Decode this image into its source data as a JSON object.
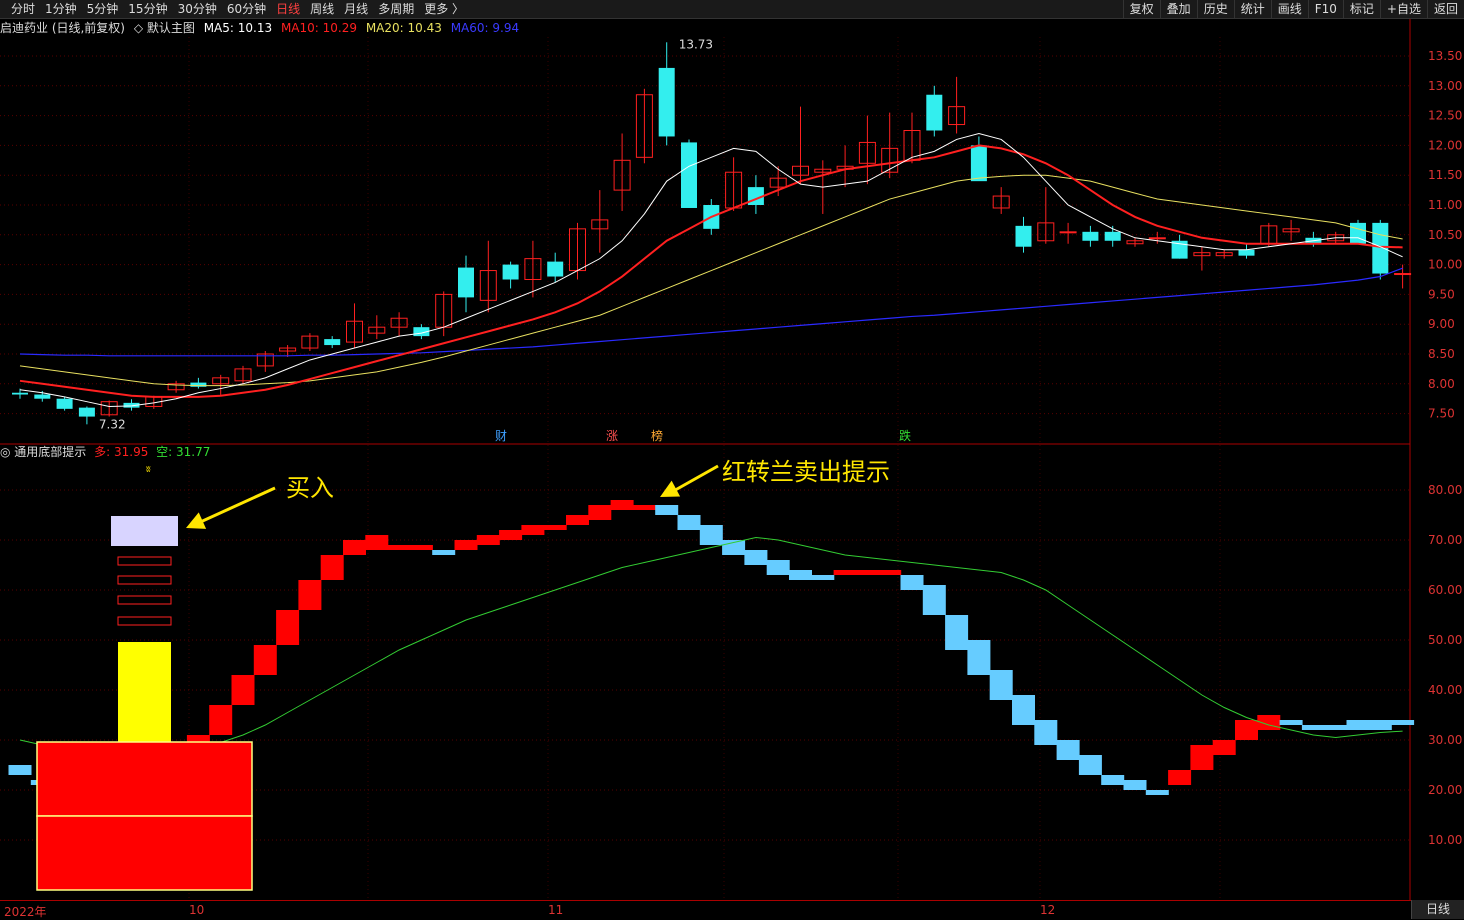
{
  "toolbar": {
    "periods": [
      "分时",
      "1分钟",
      "5分钟",
      "15分钟",
      "30分钟",
      "60分钟",
      "日线",
      "周线",
      "月线",
      "多周期",
      "更多 〉"
    ],
    "active_period": "日线",
    "right_buttons": [
      "复权",
      "叠加",
      "历史",
      "统计",
      "画线",
      "F10",
      "标记",
      "+自选",
      "返回"
    ]
  },
  "main_chart": {
    "stock_name": "启迪药业 (日线,前复权)",
    "template": "◇ 默认主图",
    "ma5": "MA5: 10.13",
    "ma10": "MA10: 10.29",
    "ma20": "MA20: 10.43",
    "ma60": "MA60: 9.94",
    "high_label": "13.73",
    "low_label": "7.32",
    "markers": [
      "财",
      "涨",
      "榜",
      "跌"
    ],
    "y_ticks": [
      "13.50",
      "13.00",
      "12.50",
      "12.00",
      "11.50",
      "11.00",
      "10.50",
      "10.00",
      "9.50",
      "9.00",
      "8.50",
      "8.00",
      "7.50"
    ]
  },
  "indicator": {
    "name": "◎ 通用底部提示",
    "long_label": "多: 31.95",
    "short_label": "空: 31.77",
    "y_ticks": [
      "80.00",
      "70.00",
      "60.00",
      "50.00",
      "40.00",
      "30.00",
      "20.00",
      "10.00"
    ],
    "annotation_buy": "买入",
    "annotation_sell": "红转兰卖出提示"
  },
  "x_axis": {
    "labels": [
      "2022年",
      "10",
      "11",
      "12"
    ],
    "period_button": "日线"
  },
  "colors": {
    "up": "#ff2020",
    "down": "#33eeee",
    "ma5": "#ffffff",
    "ma10": "#ff2020",
    "ma20": "#e8e060",
    "ma60": "#2a2aff",
    "ind_red": "#ff0000",
    "ind_blue": "#66ccff",
    "ind_line": "#33cc33",
    "annotation": "#ffe600"
  },
  "chart_data": {
    "type": "candlestick",
    "candles": [
      [
        7.85,
        7.92,
        7.75,
        7.82
      ],
      [
        7.82,
        7.88,
        7.7,
        7.75
      ],
      [
        7.75,
        7.78,
        7.55,
        7.58
      ],
      [
        7.6,
        7.62,
        7.32,
        7.45
      ],
      [
        7.48,
        7.72,
        7.45,
        7.7
      ],
      [
        7.68,
        7.74,
        7.55,
        7.6
      ],
      [
        7.62,
        7.8,
        7.58,
        7.78
      ],
      [
        7.9,
        8.05,
        7.85,
        8.0
      ],
      [
        8.02,
        8.1,
        7.92,
        7.95
      ],
      [
        8.0,
        8.15,
        7.8,
        8.1
      ],
      [
        8.05,
        8.3,
        8.0,
        8.25
      ],
      [
        8.3,
        8.55,
        8.2,
        8.5
      ],
      [
        8.55,
        8.65,
        8.45,
        8.6
      ],
      [
        8.6,
        8.85,
        8.55,
        8.8
      ],
      [
        8.75,
        8.8,
        8.6,
        8.65
      ],
      [
        8.7,
        9.35,
        8.6,
        9.05
      ],
      [
        8.85,
        9.15,
        8.75,
        8.95
      ],
      [
        8.95,
        9.2,
        8.8,
        9.1
      ],
      [
        8.95,
        9.0,
        8.75,
        8.8
      ],
      [
        8.95,
        9.55,
        8.8,
        9.5
      ],
      [
        9.95,
        10.15,
        9.2,
        9.45
      ],
      [
        9.4,
        10.4,
        9.2,
        9.9
      ],
      [
        10.0,
        10.05,
        9.6,
        9.75
      ],
      [
        9.75,
        10.4,
        9.45,
        10.1
      ],
      [
        10.05,
        10.2,
        9.7,
        9.8
      ],
      [
        9.9,
        10.7,
        9.75,
        10.6
      ],
      [
        10.6,
        11.25,
        10.2,
        10.75
      ],
      [
        11.25,
        12.2,
        10.9,
        11.75
      ],
      [
        11.8,
        12.95,
        11.7,
        12.85
      ],
      [
        13.3,
        13.73,
        12.0,
        12.15
      ],
      [
        12.05,
        12.1,
        10.95,
        10.95
      ],
      [
        11.0,
        11.1,
        10.5,
        10.6
      ],
      [
        10.95,
        11.8,
        10.9,
        11.55
      ],
      [
        11.3,
        11.5,
        10.85,
        11.0
      ],
      [
        11.3,
        11.65,
        11.15,
        11.45
      ],
      [
        11.5,
        12.65,
        11.35,
        11.65
      ],
      [
        11.55,
        11.75,
        10.85,
        11.6
      ],
      [
        11.6,
        12.0,
        11.3,
        11.65
      ],
      [
        11.7,
        12.5,
        11.35,
        12.05
      ],
      [
        11.55,
        12.55,
        11.45,
        11.95
      ],
      [
        11.75,
        12.55,
        11.7,
        12.25
      ],
      [
        12.85,
        13.0,
        12.15,
        12.25
      ],
      [
        12.35,
        13.15,
        12.2,
        12.65
      ],
      [
        12.0,
        12.15,
        11.45,
        11.4
      ],
      [
        10.95,
        11.3,
        10.85,
        11.15
      ],
      [
        10.65,
        10.8,
        10.2,
        10.3
      ],
      [
        10.4,
        11.3,
        10.35,
        10.7
      ],
      [
        10.55,
        10.7,
        10.35,
        10.55
      ],
      [
        10.55,
        10.65,
        10.3,
        10.4
      ],
      [
        10.55,
        10.65,
        10.3,
        10.4
      ],
      [
        10.35,
        10.45,
        10.3,
        10.4
      ],
      [
        10.45,
        10.55,
        10.35,
        10.45
      ],
      [
        10.4,
        10.5,
        10.1,
        10.1
      ],
      [
        10.15,
        10.3,
        9.9,
        10.2
      ],
      [
        10.15,
        10.25,
        10.1,
        10.2
      ],
      [
        10.25,
        10.35,
        10.1,
        10.15
      ],
      [
        10.35,
        10.7,
        10.3,
        10.65
      ],
      [
        10.55,
        10.75,
        10.4,
        10.6
      ],
      [
        10.45,
        10.55,
        10.3,
        10.35
      ],
      [
        10.4,
        10.55,
        10.35,
        10.5
      ],
      [
        10.7,
        10.75,
        10.35,
        10.35
      ],
      [
        10.7,
        10.75,
        9.75,
        9.85
      ],
      [
        9.85,
        10.0,
        9.6,
        9.85
      ]
    ],
    "ma5": [
      7.9,
      7.85,
      7.78,
      7.7,
      7.62,
      7.63,
      7.68,
      7.75,
      7.85,
      7.92,
      8.0,
      8.1,
      8.25,
      8.4,
      8.5,
      8.6,
      8.7,
      8.8,
      8.85,
      8.95,
      9.1,
      9.25,
      9.4,
      9.55,
      9.7,
      9.9,
      10.1,
      10.4,
      10.85,
      11.4,
      11.65,
      11.8,
      11.95,
      11.9,
      11.6,
      11.35,
      11.3,
      11.35,
      11.4,
      11.6,
      11.8,
      11.9,
      12.1,
      12.2,
      12.1,
      11.8,
      11.4,
      11.0,
      10.8,
      10.6,
      10.45,
      10.4,
      10.35,
      10.3,
      10.25,
      10.25,
      10.3,
      10.35,
      10.4,
      10.45,
      10.45,
      10.3,
      10.13
    ],
    "ma10": [
      8.05,
      8.0,
      7.95,
      7.9,
      7.85,
      7.8,
      7.78,
      7.78,
      7.78,
      7.8,
      7.85,
      7.9,
      7.98,
      8.08,
      8.18,
      8.28,
      8.38,
      8.48,
      8.58,
      8.68,
      8.78,
      8.88,
      8.98,
      9.08,
      9.2,
      9.35,
      9.55,
      9.8,
      10.1,
      10.4,
      10.6,
      10.8,
      10.95,
      11.1,
      11.25,
      11.4,
      11.5,
      11.6,
      11.65,
      11.7,
      11.75,
      11.8,
      11.9,
      12.0,
      11.95,
      11.85,
      11.7,
      11.5,
      11.25,
      11.0,
      10.8,
      10.65,
      10.55,
      10.45,
      10.4,
      10.35,
      10.35,
      10.35,
      10.35,
      10.35,
      10.35,
      10.3,
      10.29
    ],
    "ma20": [
      8.3,
      8.25,
      8.2,
      8.15,
      8.1,
      8.05,
      8.0,
      7.98,
      7.97,
      7.97,
      7.98,
      8.0,
      8.02,
      8.05,
      8.1,
      8.15,
      8.2,
      8.28,
      8.36,
      8.45,
      8.55,
      8.65,
      8.75,
      8.85,
      8.95,
      9.05,
      9.15,
      9.3,
      9.45,
      9.6,
      9.75,
      9.9,
      10.05,
      10.2,
      10.35,
      10.5,
      10.65,
      10.8,
      10.95,
      11.1,
      11.2,
      11.3,
      11.4,
      11.45,
      11.48,
      11.5,
      11.5,
      11.45,
      11.4,
      11.3,
      11.2,
      11.1,
      11.05,
      11.0,
      10.95,
      10.9,
      10.85,
      10.8,
      10.75,
      10.7,
      10.6,
      10.5,
      10.43
    ],
    "ma60": [
      8.5,
      8.49,
      8.48,
      8.48,
      8.47,
      8.47,
      8.47,
      8.47,
      8.47,
      8.47,
      8.47,
      8.47,
      8.47,
      8.48,
      8.48,
      8.49,
      8.5,
      8.51,
      8.52,
      8.54,
      8.56,
      8.58,
      8.6,
      8.62,
      8.65,
      8.68,
      8.71,
      8.74,
      8.77,
      8.8,
      8.83,
      8.86,
      8.89,
      8.92,
      8.95,
      8.98,
      9.01,
      9.04,
      9.07,
      9.1,
      9.13,
      9.15,
      9.18,
      9.21,
      9.24,
      9.27,
      9.3,
      9.33,
      9.36,
      9.39,
      9.42,
      9.45,
      9.48,
      9.51,
      9.54,
      9.57,
      9.6,
      9.63,
      9.66,
      9.7,
      9.74,
      9.8,
      9.94
    ],
    "indicator_steps": [
      [
        25,
        23,
        "b"
      ],
      [
        21,
        22,
        "b"
      ],
      [
        20,
        22,
        "b"
      ],
      [
        20,
        21,
        "b"
      ],
      [
        21,
        22,
        "b"
      ],
      [
        22,
        23,
        "b"
      ],
      [
        24,
        25,
        "b"
      ],
      [
        25,
        26,
        "r"
      ],
      [
        27,
        31,
        "r"
      ],
      [
        31,
        37,
        "r"
      ],
      [
        37,
        43,
        "r"
      ],
      [
        43,
        49,
        "r"
      ],
      [
        49,
        56,
        "r"
      ],
      [
        56,
        62,
        "r"
      ],
      [
        62,
        67,
        "r"
      ],
      [
        67,
        70,
        "r"
      ],
      [
        68,
        71,
        "r"
      ],
      [
        68,
        69,
        "r"
      ],
      [
        68,
        69,
        "r"
      ],
      [
        67,
        68,
        "b"
      ],
      [
        68,
        70,
        "r"
      ],
      [
        69,
        71,
        "r"
      ],
      [
        70,
        72,
        "r"
      ],
      [
        71,
        73,
        "r"
      ],
      [
        72,
        73,
        "r"
      ],
      [
        73,
        75,
        "r"
      ],
      [
        74,
        77,
        "r"
      ],
      [
        76,
        78,
        "r"
      ],
      [
        76,
        77,
        "r"
      ],
      [
        75,
        77,
        "b"
      ],
      [
        72,
        75,
        "b"
      ],
      [
        69,
        73,
        "b"
      ],
      [
        67,
        70,
        "b"
      ],
      [
        65,
        68,
        "b"
      ],
      [
        63,
        66,
        "b"
      ],
      [
        62,
        64,
        "b"
      ],
      [
        62,
        63,
        "b"
      ],
      [
        63,
        64,
        "r"
      ],
      [
        63,
        64,
        "r"
      ],
      [
        63,
        64,
        "r"
      ],
      [
        60,
        63,
        "b"
      ],
      [
        55,
        61,
        "b"
      ],
      [
        48,
        55,
        "b"
      ],
      [
        43,
        50,
        "b"
      ],
      [
        38,
        44,
        "b"
      ],
      [
        33,
        39,
        "b"
      ],
      [
        29,
        34,
        "b"
      ],
      [
        26,
        30,
        "b"
      ],
      [
        23,
        27,
        "b"
      ],
      [
        21,
        23,
        "b"
      ],
      [
        20,
        22,
        "b"
      ],
      [
        19,
        20,
        "b"
      ],
      [
        21,
        24,
        "r"
      ],
      [
        24,
        29,
        "r"
      ],
      [
        27,
        30,
        "r"
      ],
      [
        30,
        34,
        "r"
      ],
      [
        32,
        35,
        "r"
      ],
      [
        33,
        34,
        "b"
      ],
      [
        32,
        33,
        "b"
      ],
      [
        32,
        33,
        "b"
      ],
      [
        32,
        34,
        "b"
      ],
      [
        32,
        34,
        "b"
      ],
      [
        33,
        34,
        "b"
      ]
    ],
    "indicator_line": [
      30,
      29,
      28,
      27.5,
      27,
      27,
      27.5,
      28,
      28.5,
      29.5,
      31,
      33,
      35.5,
      38,
      40.5,
      43,
      45.5,
      48,
      50,
      52,
      54,
      55.5,
      57,
      58.5,
      60,
      61.5,
      63,
      64.5,
      65.5,
      66.5,
      67.5,
      68.5,
      69.5,
      70.5,
      70,
      69,
      68,
      67,
      66.5,
      66,
      65.5,
      65,
      64.5,
      64,
      63.5,
      62,
      60,
      57,
      54,
      51,
      48,
      45,
      42,
      39,
      36.5,
      34.5,
      33,
      32,
      31,
      30.5,
      31,
      31.5,
      31.77
    ]
  }
}
